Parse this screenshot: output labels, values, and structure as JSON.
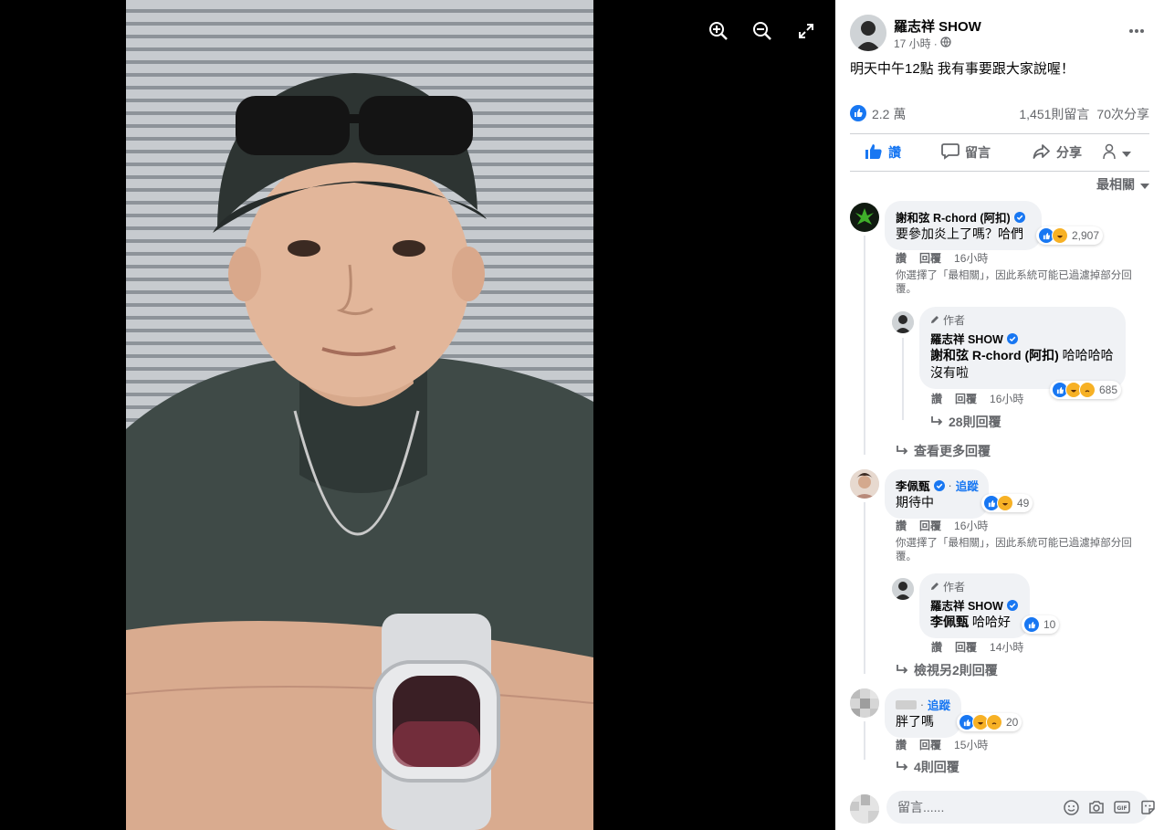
{
  "viewer": {
    "tools": [
      "zoom-in-icon",
      "zoom-out-icon",
      "fullscreen-icon"
    ]
  },
  "post": {
    "page_name": "羅志祥 SHOW",
    "time": "17 小時",
    "privacy_icon": "globe-icon",
    "text": "明天中午12點 我有事要跟大家說喔！",
    "reaction_count": "2.2 萬",
    "comment_count": "1,451則留言",
    "share_count": "70次分享"
  },
  "actions": {
    "like": "讚",
    "comment": "留言",
    "share": "分享"
  },
  "sort_label": "最相關",
  "comments": {
    "c1": {
      "name": "謝和弦 R-chord (阿扣)",
      "text": "要參加炎上了嗎？哈們",
      "reactions": "2,907",
      "like": "讚",
      "reply": "回覆",
      "time": "16小時",
      "note": "你選擇了「最相關」，因此系統可能已過濾掉部分回覆。",
      "reply1": {
        "author_tag": "作者",
        "name": "羅志祥 SHOW",
        "mention": "謝和弦 R-chord (阿扣)",
        "text": " 哈哈哈哈 沒有啦",
        "reactions": "685",
        "like": "讚",
        "reply": "回覆",
        "time": "16小時",
        "sub_replies": "28則回覆"
      },
      "more_replies": "查看更多回覆"
    },
    "c2": {
      "name": "李佩甄",
      "follow": "追蹤",
      "text": "期待中",
      "reactions": "49",
      "like": "讚",
      "reply": "回覆",
      "time": "16小時",
      "note": "你選擇了「最相關」，因此系統可能已過濾掉部分回覆。",
      "reply1": {
        "author_tag": "作者",
        "name": "羅志祥 SHOW",
        "mention": "李佩甄",
        "text": " 哈哈好",
        "reactions": "10",
        "like": "讚",
        "reply": "回覆",
        "time": "14小時"
      },
      "more_replies": "檢視另2則回覆"
    },
    "c3": {
      "follow": "追蹤",
      "text": "胖了嗎",
      "reactions": "20",
      "like": "讚",
      "reply": "回覆",
      "time": "15小時",
      "more_replies": "4則回覆"
    }
  },
  "composer": {
    "placeholder": "留言......",
    "icons": [
      "emoji-icon",
      "camera-icon",
      "gif-icon",
      "sticker-icon"
    ]
  },
  "colors": {
    "accent": "#1877f2",
    "secondary_text": "#65676b",
    "bubble": "#f0f2f5",
    "like_blue": "#1877f2",
    "haha_yellow": "#f7b125"
  }
}
